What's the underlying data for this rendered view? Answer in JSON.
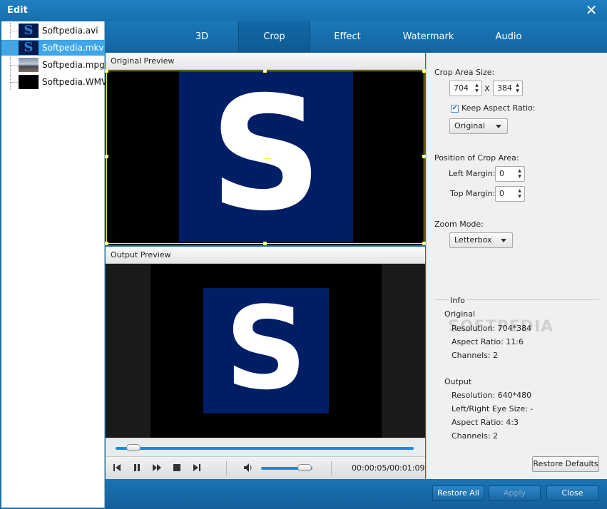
{
  "window": {
    "title": "Edit"
  },
  "files": [
    {
      "name": "Softpedia.avi",
      "selected": false
    },
    {
      "name": "Softpedia.mkv",
      "selected": true
    },
    {
      "name": "Softpedia.mpg",
      "selected": false
    },
    {
      "name": "Softpedia.WMV",
      "selected": false
    }
  ],
  "tabs": [
    "3D",
    "Crop",
    "Effect",
    "Watermark",
    "Audio"
  ],
  "active_tab": "Crop",
  "preview": {
    "original_label": "Original Preview",
    "output_label": "Output Preview",
    "frame_letter": "S",
    "seek_fraction": 0.06,
    "volume_fraction": 0.85,
    "timecode": "00:00:05/00:01:09"
  },
  "crop": {
    "area_size_label": "Crop Area Size:",
    "width": "704",
    "times": "X",
    "height": "384",
    "keep_aspect_label": "Keep Aspect Ratio:",
    "keep_aspect_checked": true,
    "aspect_value": "Original",
    "position_label": "Position of Crop Area:",
    "left_margin_label": "Left Margin:",
    "left_margin": "0",
    "top_margin_label": "Top Margin:",
    "top_margin": "0",
    "zoom_label": "Zoom Mode:",
    "zoom_value": "Letterbox"
  },
  "info": {
    "title": "Info",
    "original_title": "Original",
    "original_resolution": "Resolution: 704*384",
    "original_aspect": "Aspect Ratio: 11:6",
    "original_channels": "Channels: 2",
    "output_title": "Output",
    "output_resolution": "Resolution: 640*480",
    "output_eye_size": "Left/Right Eye Size: -",
    "output_aspect": "Aspect Ratio: 4:3",
    "output_channels": "Channels: 2",
    "watermark_text": "SOFTPEDIA"
  },
  "buttons": {
    "restore_defaults": "Restore Defaults",
    "restore_all": "Restore All",
    "apply": "Apply",
    "close": "Close"
  }
}
